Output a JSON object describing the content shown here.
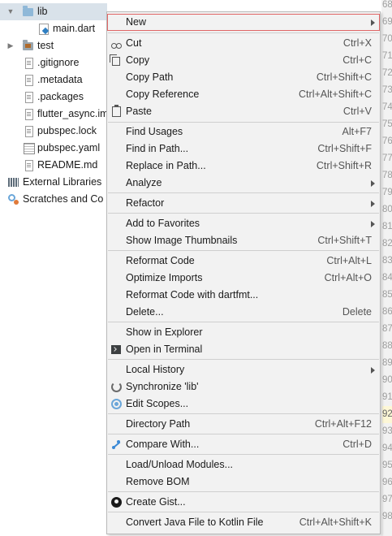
{
  "project_tree": {
    "items": [
      {
        "label": "lib"
      },
      {
        "label": "main.dart"
      },
      {
        "label": "test"
      },
      {
        "label": ".gitignore"
      },
      {
        "label": ".metadata"
      },
      {
        "label": ".packages"
      },
      {
        "label": "flutter_async.im"
      },
      {
        "label": "pubspec.lock"
      },
      {
        "label": "pubspec.yaml"
      },
      {
        "label": "README.md"
      },
      {
        "label": "External Libraries"
      },
      {
        "label": "Scratches and Co"
      }
    ]
  },
  "gutter": {
    "numbers": [
      "68",
      "69",
      "70",
      "71",
      "72",
      "73",
      "74",
      "75",
      "76",
      "77",
      "78",
      "79",
      "80",
      "81",
      "82",
      "83",
      "84",
      "85",
      "86",
      "87",
      "88",
      "89",
      "90",
      "91",
      "92",
      "93",
      "94",
      "95",
      "96",
      "97",
      "98"
    ]
  },
  "context_menu": {
    "items": [
      {
        "label": "New",
        "submenu": true
      },
      {
        "label": "Cut",
        "shortcut": "Ctrl+X",
        "icon": "scissors-icon"
      },
      {
        "label": "Copy",
        "shortcut": "Ctrl+C",
        "icon": "copy-icon"
      },
      {
        "label": "Copy Path",
        "shortcut": "Ctrl+Shift+C"
      },
      {
        "label": "Copy Reference",
        "shortcut": "Ctrl+Alt+Shift+C"
      },
      {
        "label": "Paste",
        "shortcut": "Ctrl+V",
        "icon": "clipboard-icon"
      },
      {
        "label": "Find Usages",
        "shortcut": "Alt+F7"
      },
      {
        "label": "Find in Path...",
        "shortcut": "Ctrl+Shift+F"
      },
      {
        "label": "Replace in Path...",
        "shortcut": "Ctrl+Shift+R"
      },
      {
        "label": "Analyze",
        "submenu": true
      },
      {
        "label": "Refactor",
        "submenu": true
      },
      {
        "label": "Add to Favorites",
        "submenu": true
      },
      {
        "label": "Show Image Thumbnails",
        "shortcut": "Ctrl+Shift+T"
      },
      {
        "label": "Reformat Code",
        "shortcut": "Ctrl+Alt+L"
      },
      {
        "label": "Optimize Imports",
        "shortcut": "Ctrl+Alt+O"
      },
      {
        "label": "Reformat Code with dartfmt..."
      },
      {
        "label": "Delete...",
        "shortcut": "Delete"
      },
      {
        "label": "Show in Explorer"
      },
      {
        "label": "Open in Terminal",
        "icon": "terminal-icon"
      },
      {
        "label": "Local History",
        "submenu": true
      },
      {
        "label": "Synchronize 'lib'",
        "icon": "sync-icon"
      },
      {
        "label": "Edit Scopes...",
        "icon": "scope-icon"
      },
      {
        "label": "Directory Path",
        "shortcut": "Ctrl+Alt+F12"
      },
      {
        "label": "Compare With...",
        "shortcut": "Ctrl+D",
        "icon": "compare-icon"
      },
      {
        "label": "Load/Unload Modules..."
      },
      {
        "label": "Remove BOM"
      },
      {
        "label": "Create Gist...",
        "icon": "github-icon"
      },
      {
        "label": "Convert Java File to Kotlin File",
        "shortcut": "Ctrl+Alt+Shift+K"
      }
    ]
  }
}
